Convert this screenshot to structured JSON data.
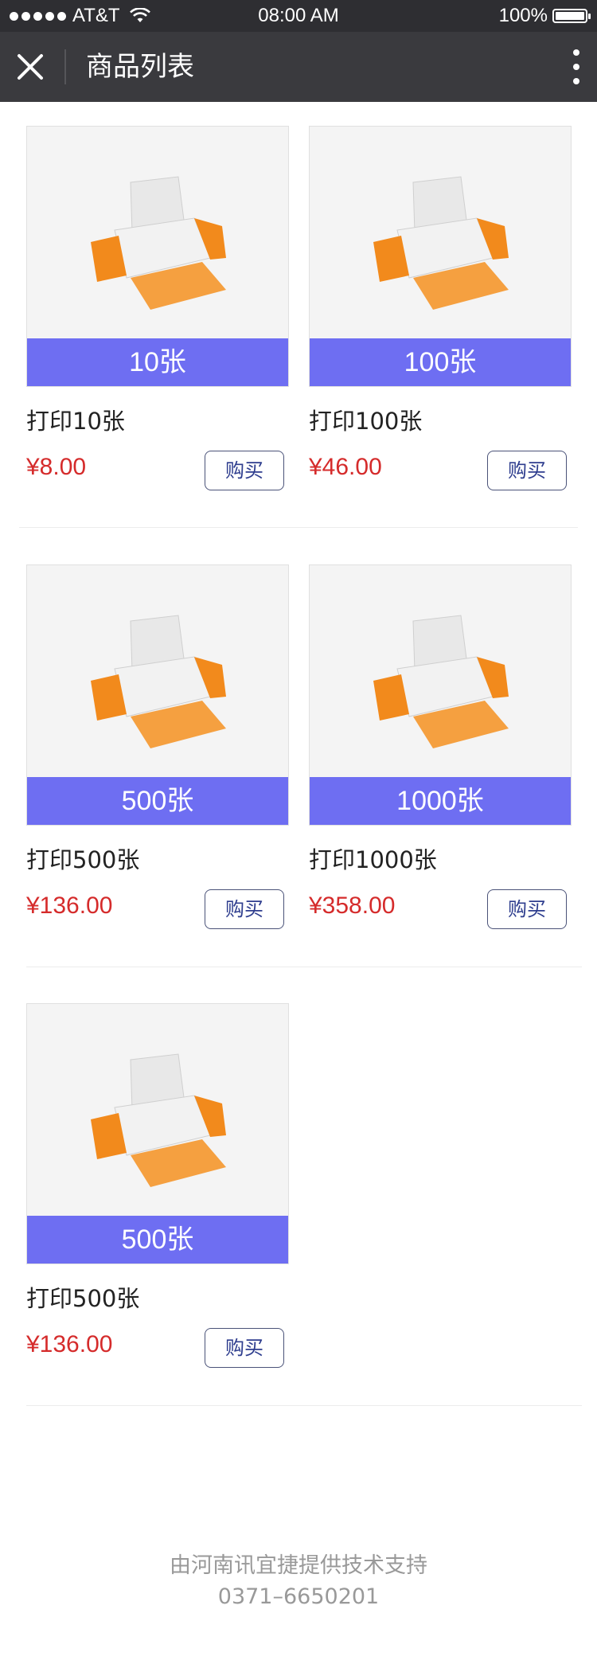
{
  "status_bar": {
    "carrier": "AT&T",
    "time": "08:00 AM",
    "battery": "100%"
  },
  "nav": {
    "title": "商品列表"
  },
  "products": [
    {
      "banner": "10张",
      "name": "打印10张",
      "price": "¥8.00",
      "buy_label": "购买"
    },
    {
      "banner": "100张",
      "name": "打印100张",
      "price": "¥46.00",
      "buy_label": "购买"
    },
    {
      "banner": "500张",
      "name": "打印500张",
      "price": "¥136.00",
      "buy_label": "购买"
    },
    {
      "banner": "1000张",
      "name": "打印1000张",
      "price": "¥358.00",
      "buy_label": "购买"
    },
    {
      "banner": "500张",
      "name": "打印500张",
      "price": "¥136.00",
      "buy_label": "购买"
    }
  ],
  "footer": {
    "line1": "由河南讯宜捷提供技术支持",
    "line2": "0371–6650201"
  },
  "colors": {
    "banner": "#6e6ef2",
    "price": "#d52b2b",
    "nav_bg": "#3a3a3e"
  }
}
